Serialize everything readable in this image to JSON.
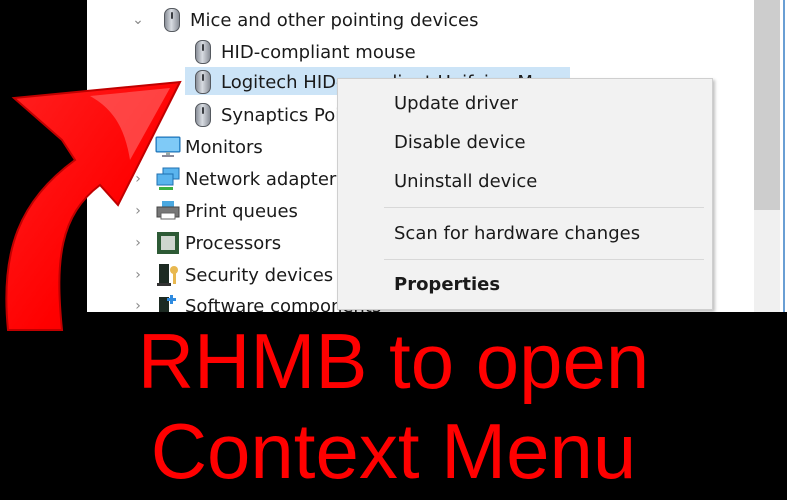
{
  "device_manager": {
    "rows": [
      {
        "label": "Mice and other pointing devices",
        "expanded": true,
        "icon": "mouse-icon"
      },
      {
        "label": "HID-compliant mouse",
        "icon": "mouse-icon"
      },
      {
        "label": "Logitech HID-compliant Unifying Mouse",
        "icon": "mouse-icon",
        "selected": true
      },
      {
        "label": "Synaptics Pointing Device",
        "icon": "mouse-icon"
      },
      {
        "label": "Monitors",
        "icon": "monitor-icon"
      },
      {
        "label": "Network adapters",
        "icon": "network-adapter-icon"
      },
      {
        "label": "Print queues",
        "icon": "printer-icon"
      },
      {
        "label": "Processors",
        "icon": "processor-icon"
      },
      {
        "label": "Security devices",
        "icon": "security-device-icon"
      },
      {
        "label": "Software components",
        "icon": "software-component-icon"
      }
    ],
    "selection_color": "#cce4f7"
  },
  "context_menu": {
    "items": [
      {
        "label": "Update driver"
      },
      {
        "label": "Disable device"
      },
      {
        "label": "Uninstall device"
      },
      {
        "label": "Scan for hardware changes"
      },
      {
        "label": "Properties",
        "bold": true
      }
    ]
  },
  "caption": {
    "line1": "RHMB to open",
    "line2": "Context Menu",
    "color": "#ff0000"
  }
}
